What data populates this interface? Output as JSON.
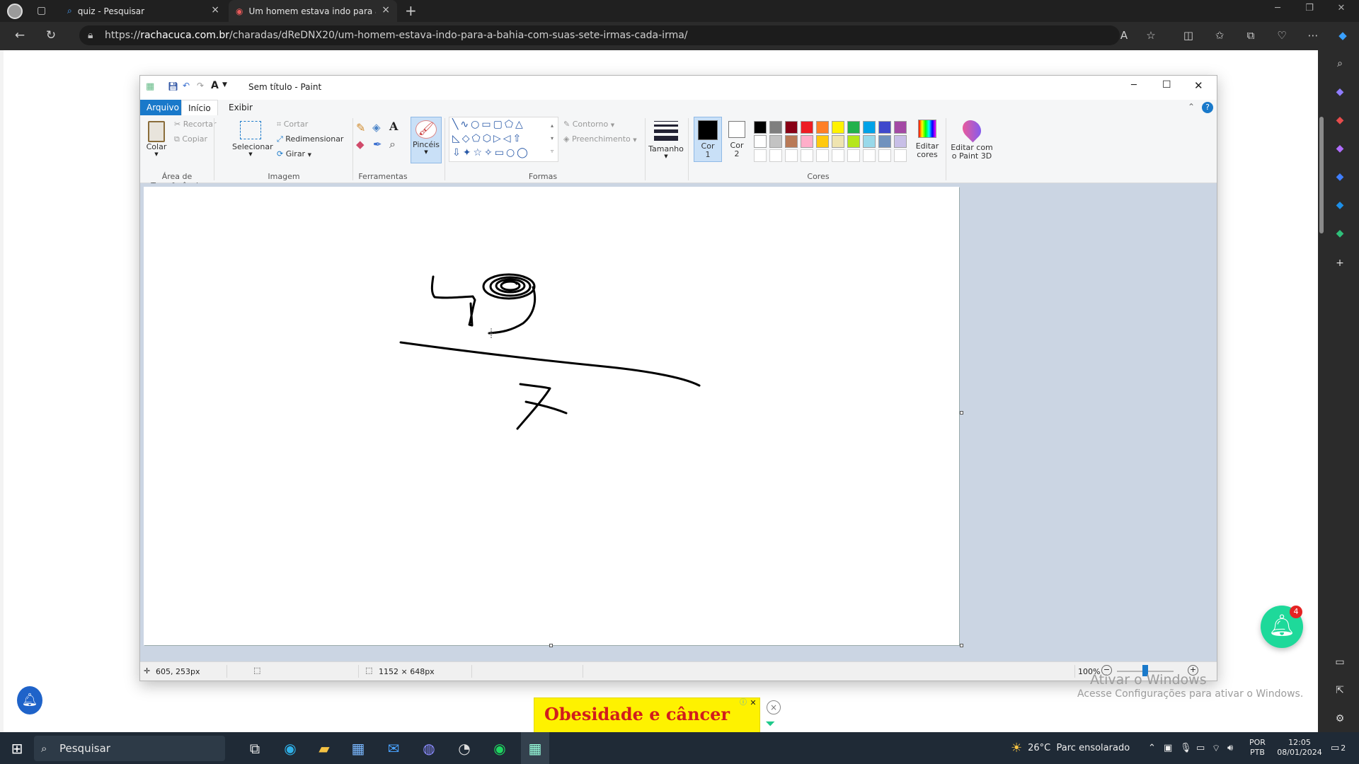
{
  "browser": {
    "tabs": [
      {
        "label": "quiz - Pesquisar",
        "icon": "search-icon"
      },
      {
        "label": "Um homem estava indo para a B",
        "icon": "site-icon"
      }
    ],
    "url_prefix": "https://",
    "url_domain": "rachacuca.com.br",
    "url_path": "/charadas/dReDNX20/um-homem-estava-indo-para-a-bahia-com-suas-sete-irmas-cada-irma/"
  },
  "paint": {
    "title": "Sem título - Paint",
    "tabs": [
      "Arquivo",
      "Início",
      "Exibir"
    ],
    "clipboard": {
      "paste": "Colar",
      "cut": "Recortar",
      "copy": "Copiar",
      "group": "Área de Transferência"
    },
    "image": {
      "select": "Selecionar",
      "crop": "Cortar",
      "resize": "Redimensionar",
      "rotate": "Girar",
      "group": "Imagem"
    },
    "tools": {
      "group": "Ferramentas"
    },
    "brushes": {
      "label": "Pincéis"
    },
    "shapes": {
      "outline": "Contorno",
      "fill": "Preenchimento",
      "group": "Formas"
    },
    "size": {
      "label": "Tamanho"
    },
    "colors": {
      "color1": "Cor 1",
      "color2": "Cor 2",
      "color1_line1": "Cor",
      "color1_line2": "1",
      "color2_line1": "Cor",
      "color2_line2": "2",
      "edit": "Editar cores",
      "edit_line1": "Editar",
      "edit_line2": "cores",
      "paint3d_line1": "Editar com",
      "paint3d_line2": "o Paint 3D",
      "group": "Cores",
      "palette_row1": [
        "#000000",
        "#7f7f7f",
        "#880015",
        "#ed1c24",
        "#ff7f27",
        "#fff200",
        "#22b14c",
        "#00a2e8",
        "#3f48cc",
        "#a349a4"
      ],
      "palette_row2": [
        "#ffffff",
        "#c3c3c3",
        "#b97a57",
        "#ffaec9",
        "#ffc90e",
        "#efe4b0",
        "#b5e61d",
        "#99d9ea",
        "#7092be",
        "#c8bfe7"
      ]
    },
    "status": {
      "cursor": "605, 253px",
      "canvas_size": "1152 × 648px",
      "zoom": "100%"
    }
  },
  "page": {
    "ad_text": "Obesidade e câncer",
    "notif_count": "4",
    "watermark_title": "Ativar o Windows",
    "watermark_sub": "Acesse Configurações para ativar o Windows."
  },
  "taskbar": {
    "search": "Pesquisar",
    "weather": "26°C  Parc ensolarado",
    "lang1": "POR",
    "lang2": "PTB",
    "time": "12:05",
    "date": "08/01/2024",
    "notifications": "2"
  }
}
